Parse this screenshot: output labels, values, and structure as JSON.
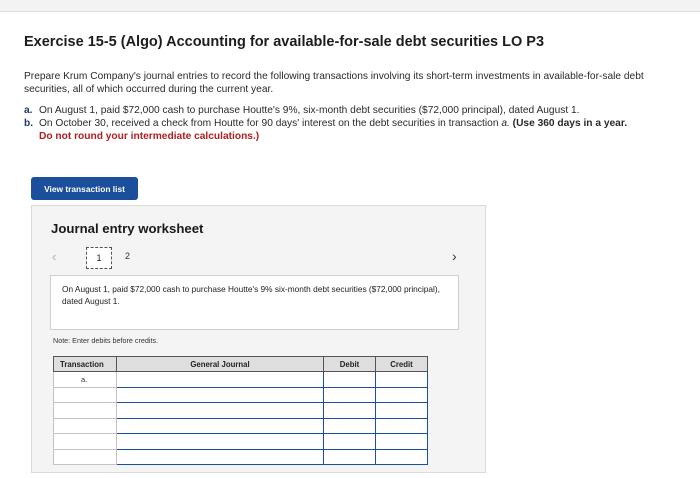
{
  "exercise": {
    "title": "Exercise 15-5 (Algo) Accounting for available-for-sale debt securities LO P3",
    "intro": "Prepare Krum Company's journal entries to record the following transactions involving its short-term investments in available-for-sale debt securities, all of which occurred during the current year.",
    "items": [
      {
        "marker": "a.",
        "text": "On August 1, paid $72,000 cash to purchase Houtte's 9%, six-month debt securities ($72,000 principal), dated August 1."
      },
      {
        "marker": "b.",
        "text": "On October 30, received a check from Houtte for 90 days' interest on the debt securities in transaction ",
        "emph": "a.",
        "bold_text": "(Use 360 days in a year.",
        "bold_text_2": "Do not round your intermediate calculations.)"
      }
    ]
  },
  "view_button": {
    "label": "View transaction list"
  },
  "worksheet": {
    "title": "Journal entry worksheet",
    "prev_icon": "‹",
    "next_icon": "›",
    "pages": [
      "1",
      "2"
    ],
    "description": "On August 1, paid $72,000 cash to purchase Houtte's 9% six-month debt securities ($72,000 principal), dated August 1.",
    "note": "Note: Enter debits before credits.",
    "table": {
      "headers": [
        "Transaction",
        "General Journal",
        "Debit",
        "Credit"
      ],
      "rows": [
        {
          "transaction": "a."
        },
        {
          "transaction": ""
        },
        {
          "transaction": ""
        },
        {
          "transaction": ""
        },
        {
          "transaction": ""
        },
        {
          "transaction": ""
        }
      ]
    }
  },
  "colors": {
    "accent": "#1b4f9c",
    "emphasis_red": "#b02020"
  }
}
